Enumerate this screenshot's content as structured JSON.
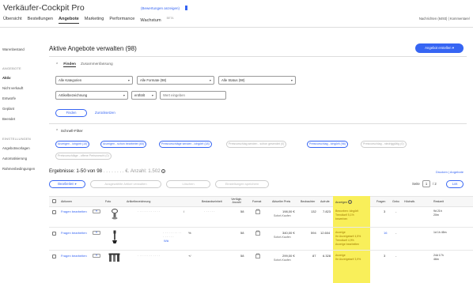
{
  "app": {
    "title": "Verkäufer-Cockpit Pro",
    "ratings_link": "(Bewertungen anzeigen)"
  },
  "topnav": {
    "items": [
      {
        "label": "Übersicht",
        "active": false
      },
      {
        "label": "Bestellungen",
        "active": false
      },
      {
        "label": "Angebote",
        "active": true
      },
      {
        "label": "Marketing",
        "active": false
      },
      {
        "label": "Performance",
        "active": false
      },
      {
        "label": "Wachstum",
        "active": false,
        "badge": "BETA"
      }
    ],
    "right_text": "Nachrichten (6493) | Kommentare/"
  },
  "sidebar": {
    "top_item": "Warenbestand",
    "section1_title": "ANGEBOTE",
    "section1_items": [
      {
        "label": "Aktiv",
        "active": true
      },
      {
        "label": "Nicht verkauft",
        "active": false
      },
      {
        "label": "Entwürfe",
        "active": false
      },
      {
        "label": "Geplant",
        "active": false
      },
      {
        "label": "Beendet",
        "active": false
      }
    ],
    "section2_title": "EINSTELLUNGEN",
    "section2_items": [
      {
        "label": "Angebotsvorlagen"
      },
      {
        "label": "Automatisierung"
      },
      {
        "label": "Rahmenbedingungen"
      }
    ]
  },
  "main": {
    "title": "Aktive Angebote verwalten (98)",
    "create_button": "Angebot erstellen",
    "tabs": {
      "find": "Finden",
      "summary": "Zusammenfassung"
    },
    "filters": {
      "category": "Alle Kategorien",
      "format": "Alle Formate (98)",
      "status": "Alle Status (98)",
      "field": "Artikelbezeichnung",
      "match": "enthält",
      "search_placeholder": "Wert eingeben"
    },
    "find_button": "Finden",
    "reset_link": "Zurücksetzen",
    "quick_filter_title": "Schnell-Filter",
    "quick_filters": [
      {
        "label": "Anzeigen - lohgörlt (15)",
        "enabled": true
      },
      {
        "label": "Anzeigen - schon bearbeitet (65)",
        "enabled": true
      },
      {
        "label": "Preisvorschläge senden - lohgörlt (18)",
        "enabled": true
      },
      {
        "label": "Preisvorschlag senden - schon gesendet (0)",
        "enabled": false
      },
      {
        "label": "Preisvorschlag - lohgörlt (98)",
        "enabled": true
      },
      {
        "label": "Preisvorschlag - niedriggültig (0)",
        "enabled": false
      },
      {
        "label": "Preisvorschläge - offene Preisvorschl (0)",
        "enabled": false
      }
    ],
    "results_text": "Ergebnisse: 1-50 von 98",
    "results_masked": ". . . . . . . . €. Anzahl: 1.502",
    "print_links": "Drucken | Angebote",
    "actions": {
      "edit": "Bearbeiten",
      "selected_actions": "Ausgewählte Artikel verwalten",
      "action2": "Löschen",
      "action3": "Einstellungen speichern"
    },
    "pager": {
      "label": "Seite",
      "current": "1",
      "total": "/ 2",
      "per_page": "Los"
    }
  },
  "table": {
    "headers": [
      "Aktionen",
      "Foto",
      "Artikelbezeichnung",
      "Bestandseinheit",
      "Verfügb. Anzahl",
      "Format",
      "Aktueller Preis",
      "Beobachter",
      "Aufrufe",
      "Anzeigen",
      "Fragen",
      "Gebo",
      "Höchstb.",
      "Restzeit"
    ],
    "rows": [
      {
        "action": "Fragen bearbeiten",
        "title": "· · · · · · · · · · · ·",
        "title_suffix": "/",
        "sku": "· · · · · ·",
        "qty": "58",
        "price": "198,00 €",
        "price_sub": "Sofort-Kaufen",
        "watchers": "132",
        "views": "7.823",
        "promo": [
          "Beworben: lohgörlt",
          "Trendtarif 5,1%",
          "bewerben"
        ],
        "questions": "3",
        "bids": "-",
        "time": [
          "9d 21h",
          "20m"
        ]
      },
      {
        "action": "Fragen bearbeiten",
        "title": "· · · · · · · · · ·",
        "title_suffix": "%",
        "title_sub": "· · · · · ·",
        "title_link": "Wä",
        "sku": "",
        "qty": "58",
        "price": "340,00 €",
        "price_sub": "Sofort-Kaufen",
        "watchers": "594",
        "views": "12.604",
        "promo": [
          "Anzeige",
          "Ihr Anzeigetarif 4,5%",
          "Trendtarif 4,9%",
          "Anzeige bearbeiten"
        ],
        "questions": "16",
        "bids": "-",
        "time": [
          "1d 1h 45m"
        ]
      },
      {
        "action": "Fragen bearbeiten",
        "title": "· · · · · · · · · · · ·",
        "title_suffix": "+/",
        "sku": "",
        "qty": "58",
        "price": "299,00 €",
        "price_sub": "Sofort-Kaufen",
        "watchers": "87",
        "views": "6.328",
        "promo": [
          "Anzeige",
          "Ihr Anzeigetarif 3,9%"
        ],
        "questions": "3",
        "bids": "-",
        "time": [
          "24d 17h",
          "46m"
        ]
      }
    ]
  },
  "colors": {
    "accent": "#3665f3",
    "highlight": "#f9ef5a"
  }
}
